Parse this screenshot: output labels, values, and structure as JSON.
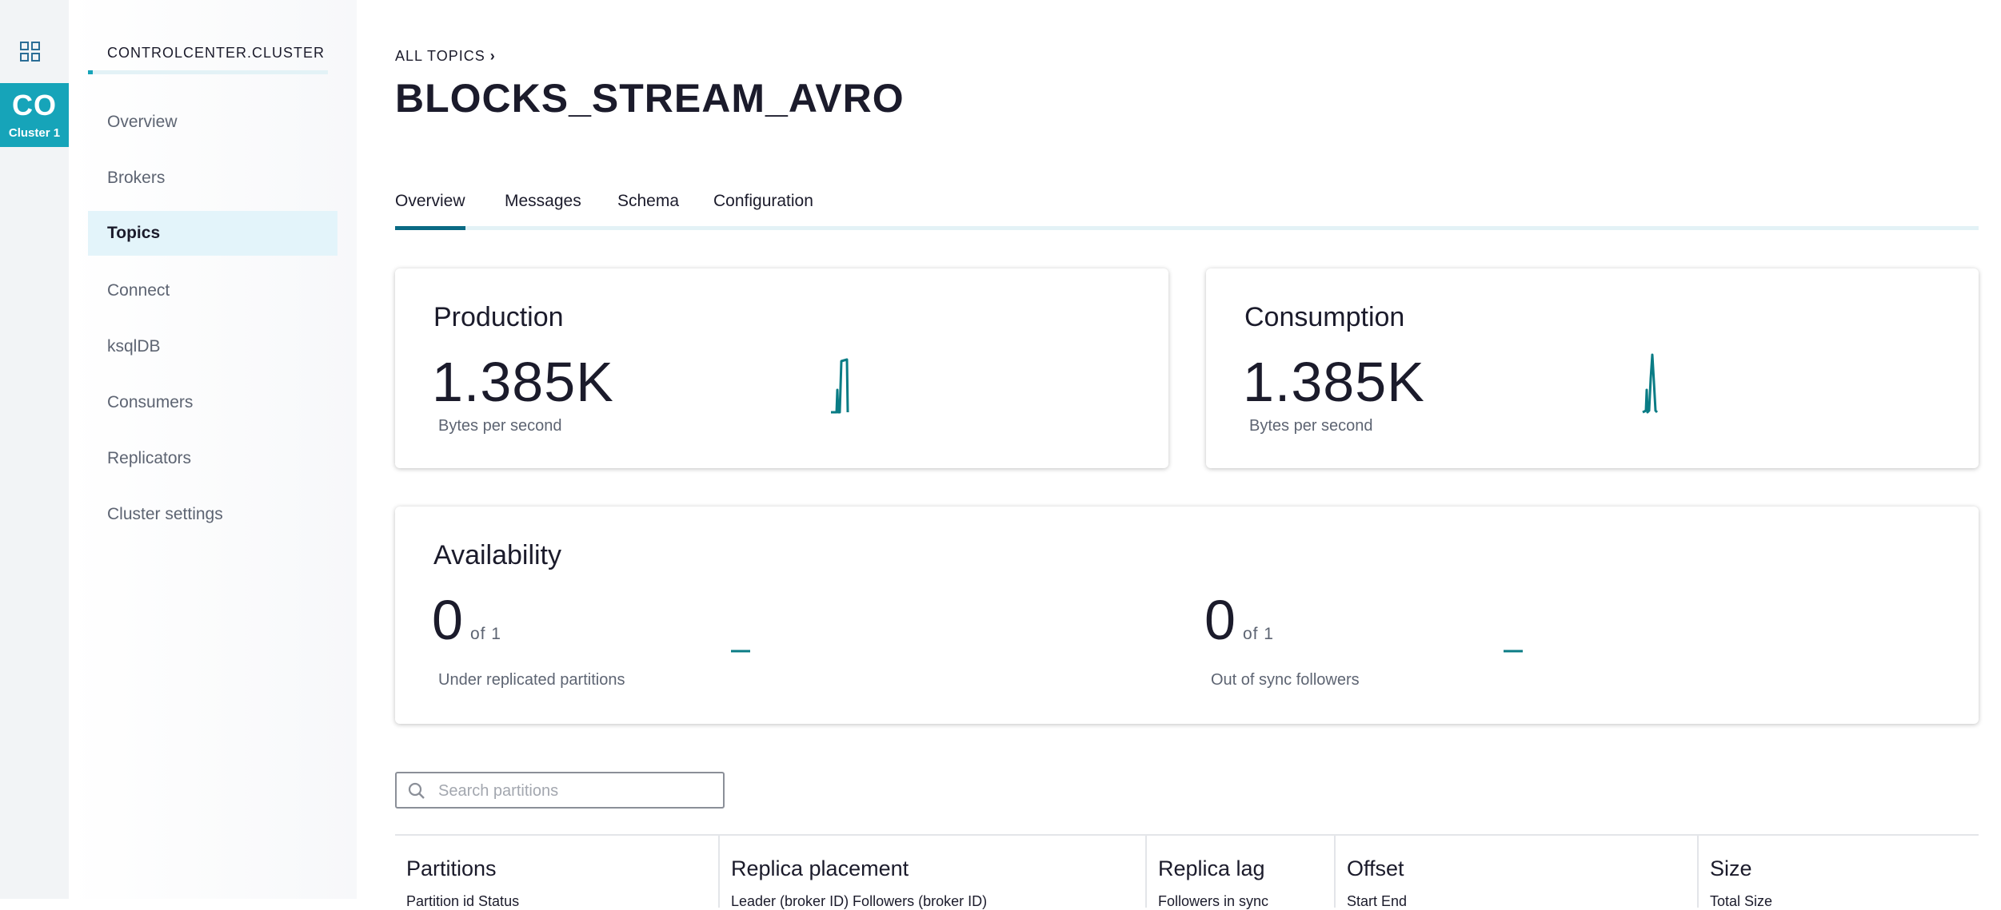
{
  "rail": {
    "cluster_abbr": "CO",
    "cluster_name": "Cluster 1",
    "accent": "#16a4b9"
  },
  "nav": {
    "title": "CONTROLCENTER.CLUSTER",
    "items": [
      {
        "label": "Overview"
      },
      {
        "label": "Brokers"
      },
      {
        "label": "Topics",
        "active": true
      },
      {
        "label": "Connect"
      },
      {
        "label": "ksqlDB"
      },
      {
        "label": "Consumers"
      },
      {
        "label": "Replicators"
      },
      {
        "label": "Cluster settings"
      }
    ]
  },
  "breadcrumb": {
    "label": "ALL TOPICS"
  },
  "page": {
    "title": "BLOCKS_STREAM_AVRO"
  },
  "tabs": [
    {
      "label": "Overview",
      "active": true
    },
    {
      "label": "Messages"
    },
    {
      "label": "Schema"
    },
    {
      "label": "Configuration"
    }
  ],
  "production": {
    "title": "Production",
    "value": "1.385K",
    "unit": "Bytes per second"
  },
  "consumption": {
    "title": "Consumption",
    "value": "1.385K",
    "unit": "Bytes per second"
  },
  "availability": {
    "title": "Availability",
    "under_replicated": {
      "value": "0",
      "of": "of 1",
      "label": "Under replicated partitions"
    },
    "out_of_sync": {
      "value": "0",
      "of": "of 1",
      "label": "Out of sync followers"
    }
  },
  "search": {
    "placeholder": "Search partitions",
    "value": ""
  },
  "table": {
    "columns": [
      {
        "label": "Partitions",
        "sub": "Partition id       Status"
      },
      {
        "label": "Replica placement",
        "sub": "Leader (broker ID)       Followers (broker ID)"
      },
      {
        "label": "Replica lag",
        "sub": "Followers in sync"
      },
      {
        "label": "Offset",
        "sub": "Start                    End"
      },
      {
        "label": "Size",
        "sub": "Total Size"
      }
    ]
  },
  "colors": {
    "spark": "#0a7c85",
    "tab_active": "#0a6a84"
  }
}
